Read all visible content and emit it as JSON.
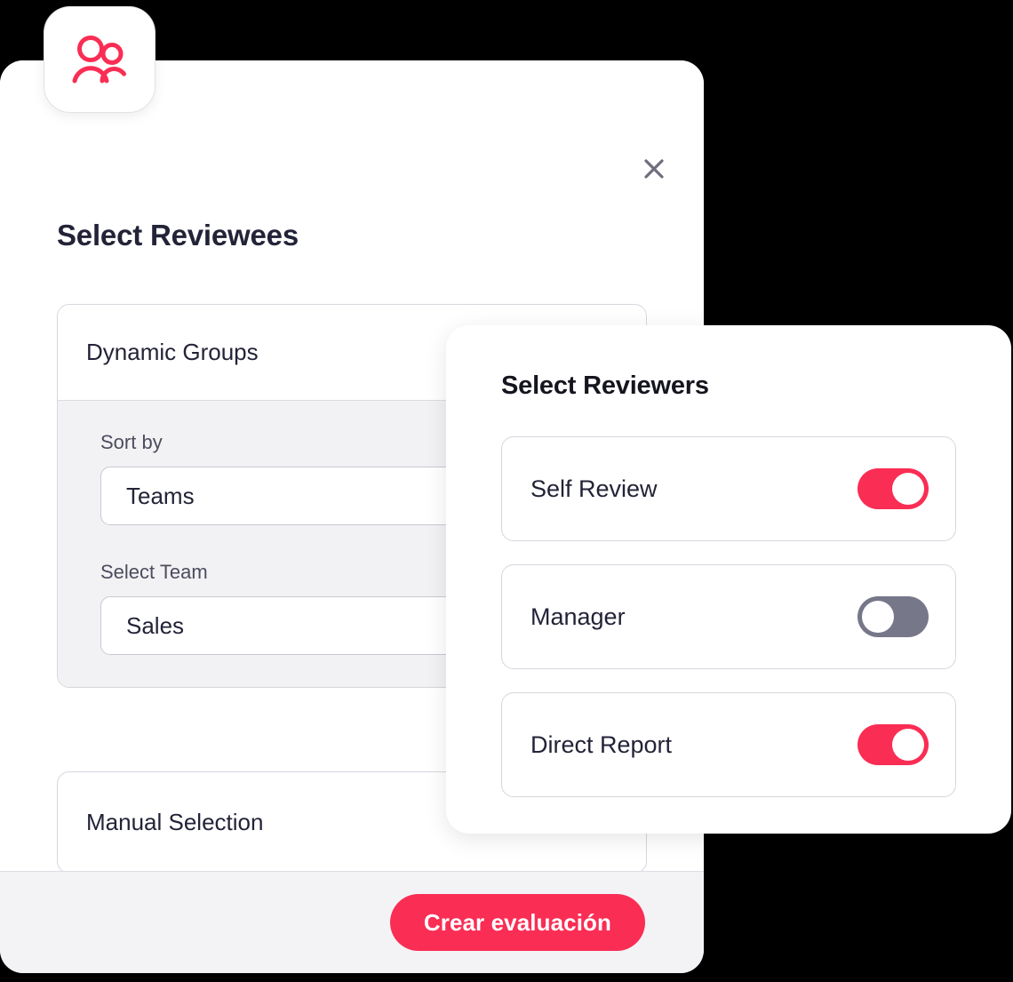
{
  "badge": {
    "icon": "users-icon",
    "color": "#fa2d54"
  },
  "reviewees_dialog": {
    "title": "Select Reviewees",
    "close_icon": "close-icon",
    "options": [
      {
        "label": "Dynamic Groups",
        "selected": true,
        "control": "radio-selected",
        "fields": [
          {
            "label": "Sort by",
            "value": "Teams"
          },
          {
            "label": "Select Team",
            "value": "Sales"
          }
        ]
      },
      {
        "label": "Manual Selection",
        "selected": false
      }
    ],
    "footer": {
      "primary_button": "Crear evaluación"
    }
  },
  "reviewers_dialog": {
    "title": "Select Reviewers",
    "toggles": [
      {
        "label": "Self Review",
        "state": "on"
      },
      {
        "label": "Manager",
        "state": "off"
      },
      {
        "label": "Direct Report",
        "state": "on"
      }
    ]
  },
  "colors": {
    "accent": "#fa2d54",
    "text_dark": "#232338",
    "text_muted": "#4c4c5e",
    "toggle_off": "#77778a",
    "panel_gray": "#f2f2f4",
    "footer_gray": "#f3f3f5",
    "border": "#d6d6de"
  }
}
